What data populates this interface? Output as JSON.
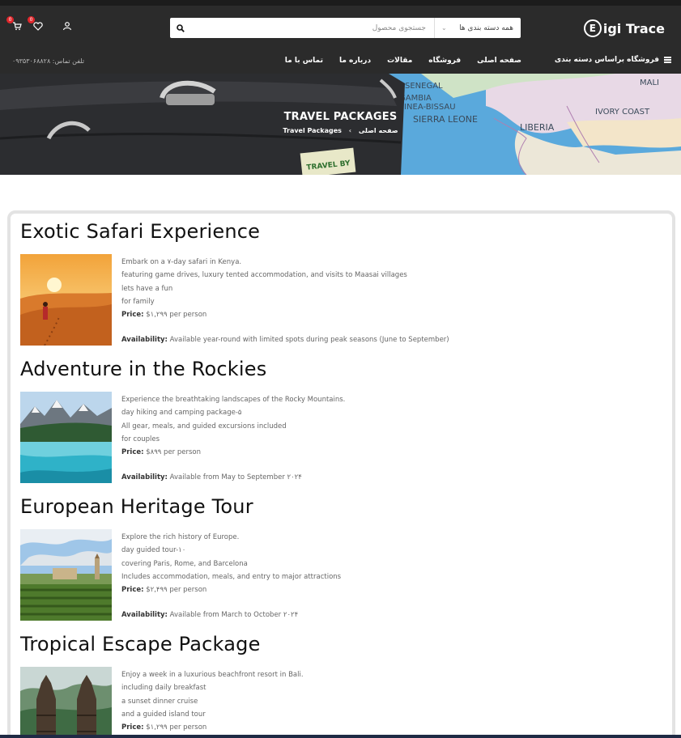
{
  "header": {
    "logo_mark": "E",
    "logo_text": "igi Trace",
    "search": {
      "category_label": "همه دسته بندی ها",
      "placeholder": "جستجوی محصول"
    },
    "cart_count": "0",
    "wishlist_count": "0"
  },
  "nav": {
    "category_menu_label": "فروشگاه براساس دسته بندی",
    "links": [
      "صفحه اصلی",
      "فروشگاه",
      "مقالات",
      "درباره ما",
      "تماس با ما"
    ],
    "phone": "تلفن تماس: ۰۹۳۵۳۰۶۸۸۲۸"
  },
  "hero": {
    "title": "TRAVEL PACKAGES",
    "breadcrumb_home": "صفحه اصلی",
    "breadcrumb_sep": "›",
    "breadcrumb_current": "Travel Packages",
    "map_labels": [
      "SENEGAL",
      "GAMBIA",
      "GUINEA-BISSAU",
      "SIERRA LEONE",
      "LIBERIA",
      "IVORY COAST",
      "MALI",
      "TRAVEL BY"
    ]
  },
  "packages": [
    {
      "title": "Exotic Safari Experience",
      "lines": [
        "Embark on a ۷-day safari in Kenya.",
        "featuring game drives, luxury tented accommodation, and visits to Maasai villages",
        "lets have a fun",
        "for family"
      ],
      "price_label": "Price:",
      "price_value": "$۱,۲۹۹ per person",
      "availability_label": "Availability:",
      "availability_value": "Available year-round with limited spots during peak seasons (June to September)"
    },
    {
      "title": "Adventure in the Rockies",
      "lines": [
        "Experience the breathtaking landscapes of the Rocky Mountains.",
        "day hiking and camping package-۵",
        "All gear, meals, and guided excursions included",
        "for couples"
      ],
      "price_label": "Price:",
      "price_value": "$۸۹۹ per person",
      "availability_label": "Availability:",
      "availability_value": "Available from May to September ۲۰۲۴"
    },
    {
      "title": "European Heritage Tour",
      "lines": [
        "Explore the rich history of Europe.",
        "day guided tour-۱۰",
        "covering Paris, Rome, and Barcelona",
        "Includes accommodation, meals, and entry to major attractions"
      ],
      "price_label": "Price:",
      "price_value": "$۲,۴۹۹ per person",
      "availability_label": "Availability:",
      "availability_value": "Available from March to October ۲۰۲۴"
    },
    {
      "title": "Tropical Escape Package",
      "lines": [
        "Enjoy a week in a luxurious beachfront resort in Bali.",
        "including daily breakfast",
        "a sunset dinner cruise",
        "and a guided island tour"
      ],
      "price_label": "Price:",
      "price_value": "$۱,۲۹۹ per person",
      "availability_label": "",
      "availability_value": ""
    }
  ]
}
